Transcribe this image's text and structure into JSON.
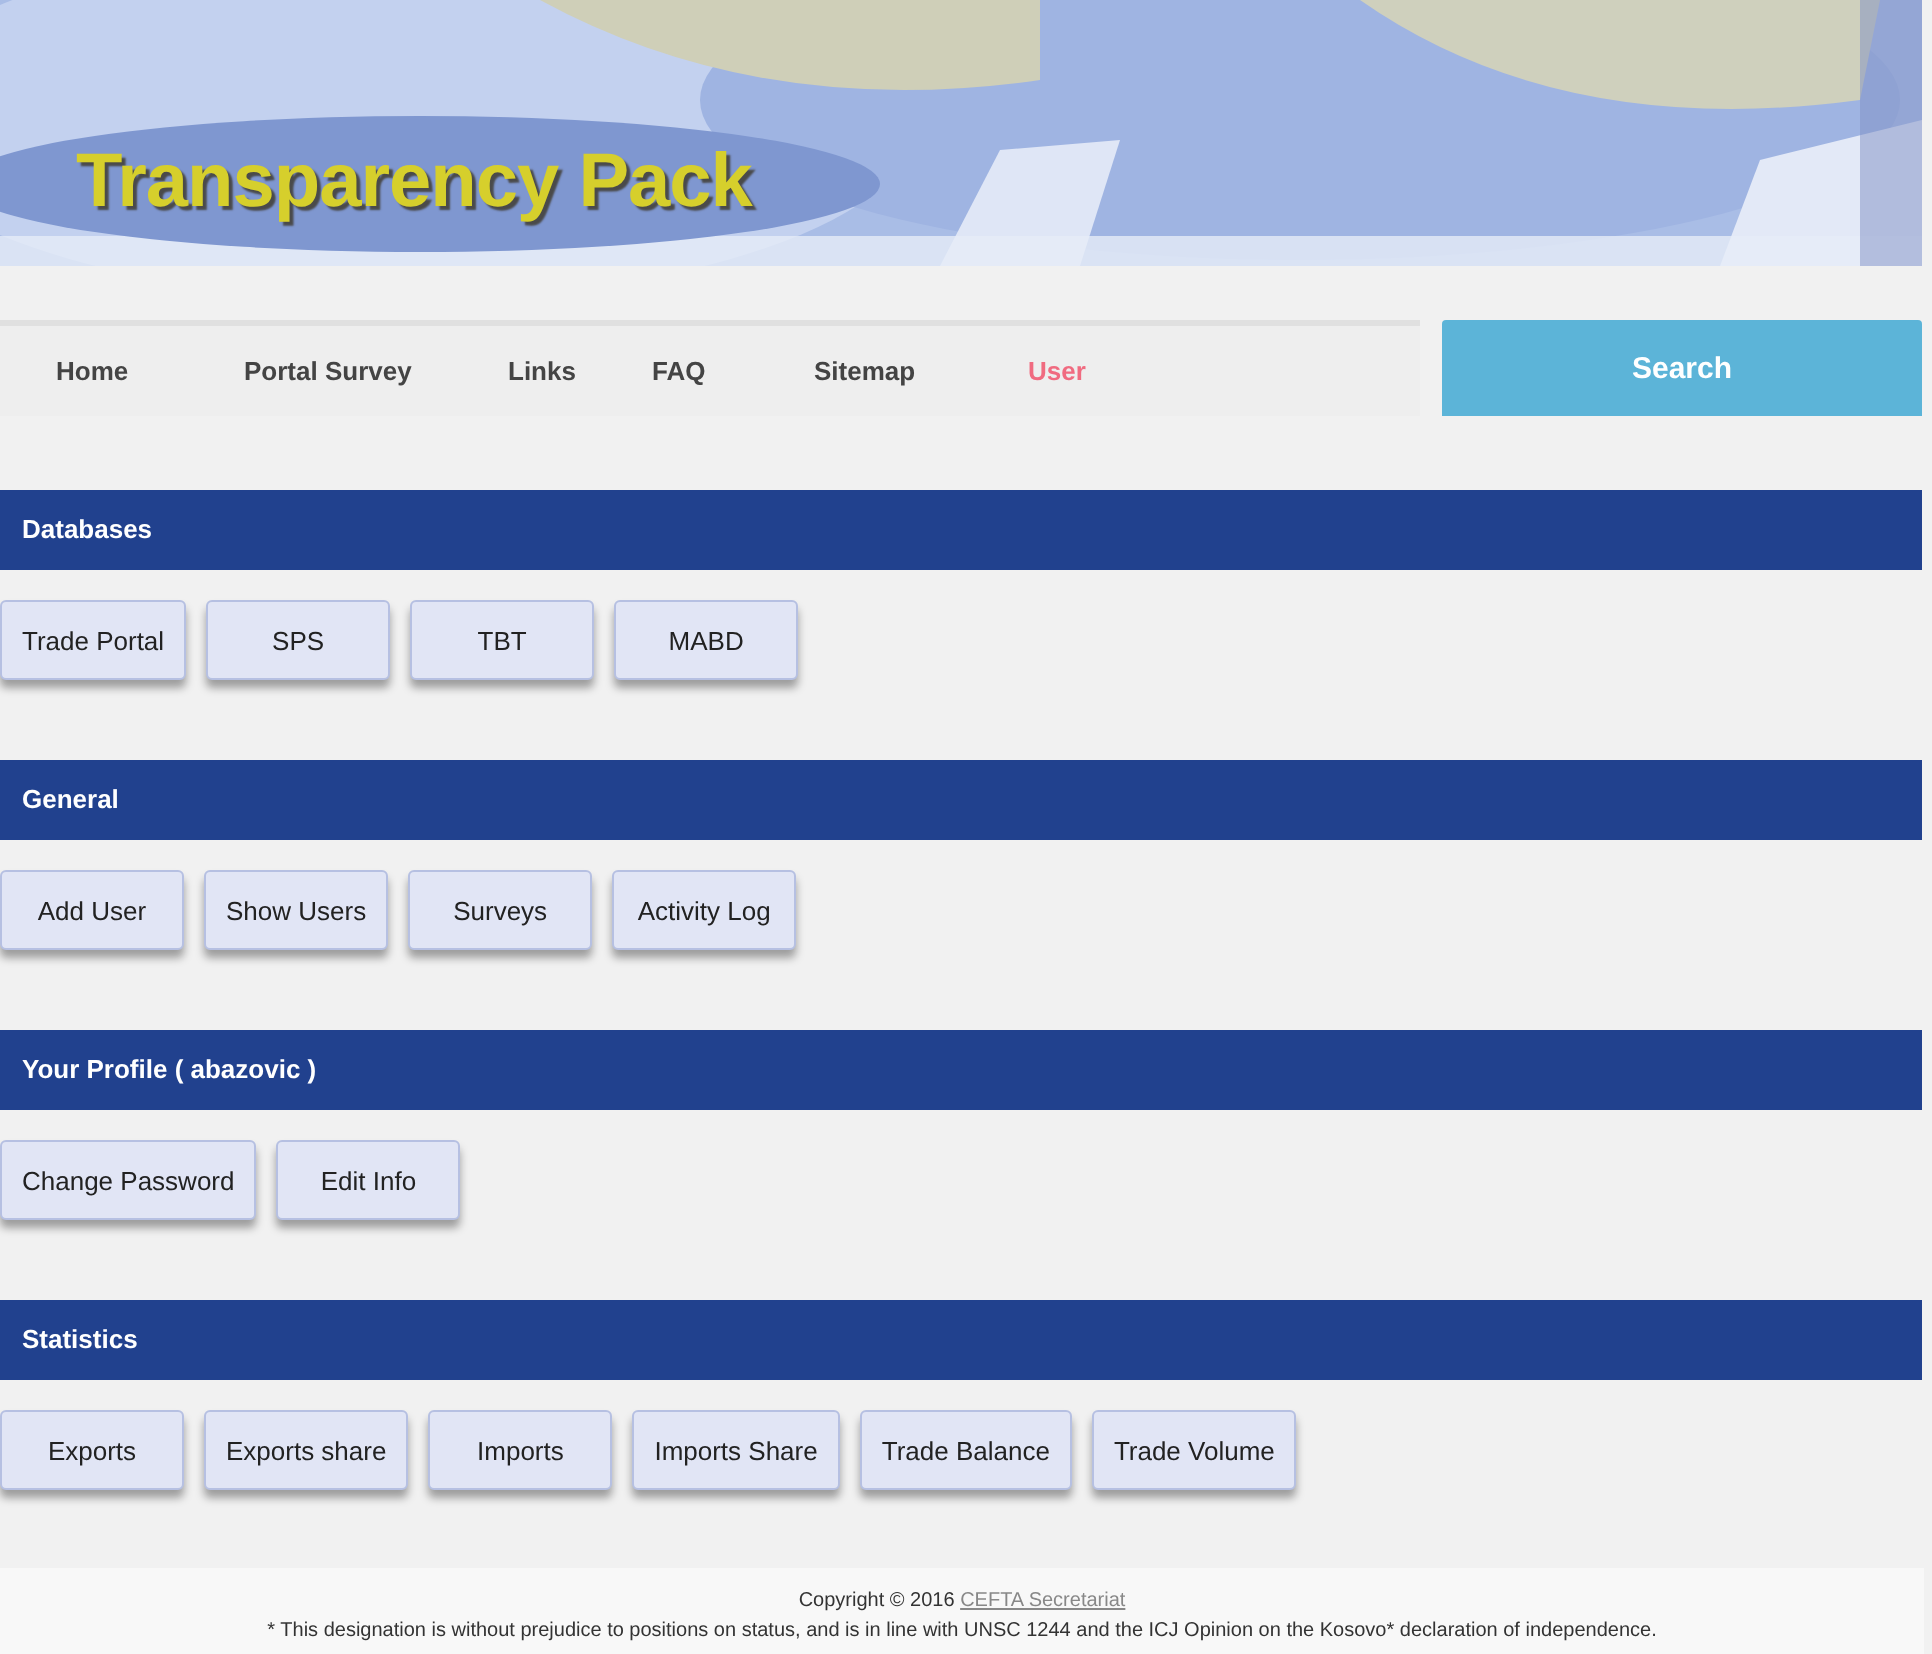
{
  "header": {
    "title": "Transparency Pack"
  },
  "nav": {
    "items": [
      {
        "label": "Home",
        "selected": false
      },
      {
        "label": "Portal Survey",
        "selected": false
      },
      {
        "label": "Links",
        "selected": false
      },
      {
        "label": "FAQ",
        "selected": false
      },
      {
        "label": "Sitemap",
        "selected": false
      },
      {
        "label": "User",
        "selected": true
      }
    ],
    "search_button": "Search"
  },
  "sections": [
    {
      "title": "Databases",
      "buttons": [
        "Trade Portal",
        "SPS",
        "TBT",
        "MABD"
      ]
    },
    {
      "title": "General",
      "buttons": [
        "Add User",
        "Show Users",
        "Surveys",
        "Activity Log"
      ]
    },
    {
      "title": "Your Profile ( abazovic )",
      "buttons": [
        "Change Password",
        "Edit Info"
      ]
    },
    {
      "title": "Statistics",
      "buttons": [
        "Exports",
        "Exports share",
        "Imports",
        "Imports Share",
        "Trade Balance",
        "Trade Volume"
      ]
    }
  ],
  "footer": {
    "copyright": "Copyright © 2016",
    "link": "CEFTA Secretariat",
    "note": "* This designation is without prejudice to positions on status, and is in line with UNSC 1244 and the ICJ Opinion on the Kosovo* declaration of independence."
  }
}
